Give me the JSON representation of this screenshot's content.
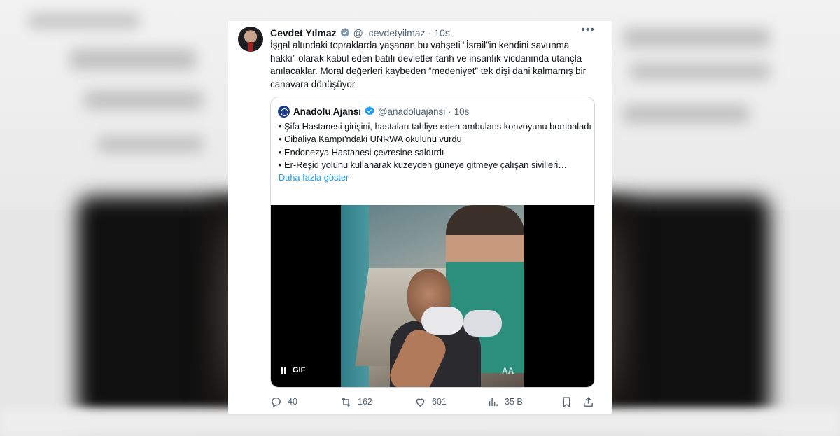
{
  "tweet": {
    "author_name": "Cevdet Yılmaz",
    "handle": "@_cevdetyilmaz",
    "separator": "·",
    "time": "10s",
    "more_icon": "more-horizontal-icon",
    "text": "İşgal altındaki topraklarda yaşanan bu vahşeti “İsrail”in kendini savunma hakkı” olarak kabul eden batılı devletler tarih ve insanlık vicdanında utançla anılacaklar. Moral değerleri kaybeden “medeniyet” tek dişi dahi kalmamış bir canavara dönüşüyor."
  },
  "quote": {
    "author_name": "Anadolu Ajansı",
    "handle": "@anadoluajansi",
    "separator": "·",
    "time": "10s",
    "lines": [
      "• Şifa Hastanesi girişini, hastaları tahliye eden ambulans konvoyunu bombaladı",
      "• Cibaliya Kampı'ndaki UNRWA okulunu vurdu",
      "• Endonezya Hastanesi çevresine saldırdı",
      "• Er-Reşid yolunu kullanarak kuzeyden güneye gitmeye çalışan sivilleri…"
    ],
    "show_more": "Daha fazla göster",
    "media": {
      "badge": "GIF",
      "watermark": "AA"
    }
  },
  "actions": {
    "replies": "40",
    "reposts": "162",
    "likes": "601",
    "views": "35 B"
  },
  "colors": {
    "accent": "#1d9bf0",
    "text": "#0f1419",
    "muted": "#536471",
    "border": "#cfd9de"
  }
}
